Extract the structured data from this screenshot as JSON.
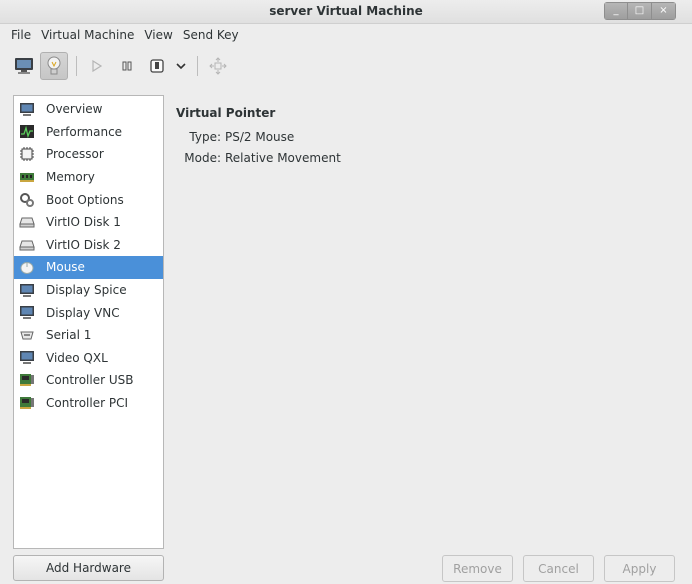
{
  "window": {
    "title": "server Virtual Machine",
    "minimize_label": "_",
    "maximize_label": "□",
    "close_label": "×"
  },
  "menu": {
    "file": "File",
    "virtual_machine": "Virtual Machine",
    "view": "View",
    "send_key": "Send Key"
  },
  "toolbar": {
    "icons": [
      "console-icon",
      "lightbulb-icon",
      "run-icon",
      "pause-icon",
      "shutdown-icon",
      "dropdown-icon",
      "fullscreen-icon"
    ]
  },
  "sidebar": {
    "items": [
      {
        "label": "Overview",
        "icon": "monitor-icon"
      },
      {
        "label": "Performance",
        "icon": "performance-icon"
      },
      {
        "label": "Processor",
        "icon": "cpu-icon"
      },
      {
        "label": "Memory",
        "icon": "memory-icon"
      },
      {
        "label": "Boot Options",
        "icon": "boot-icon"
      },
      {
        "label": "VirtIO Disk 1",
        "icon": "disk-icon"
      },
      {
        "label": "VirtIO Disk 2",
        "icon": "disk-icon"
      },
      {
        "label": "Mouse",
        "icon": "mouse-icon",
        "selected": true
      },
      {
        "label": "Display Spice",
        "icon": "display-icon"
      },
      {
        "label": "Display VNC",
        "icon": "display-icon"
      },
      {
        "label": "Serial 1",
        "icon": "serial-icon"
      },
      {
        "label": "Video QXL",
        "icon": "display-icon"
      },
      {
        "label": "Controller USB",
        "icon": "controller-icon"
      },
      {
        "label": "Controller PCI",
        "icon": "controller-icon"
      }
    ],
    "add_hardware": "Add Hardware"
  },
  "details": {
    "section_title": "Virtual Pointer",
    "type_label": "Type:",
    "type_value": "PS/2 Mouse",
    "mode_label": "Mode:",
    "mode_value": "Relative Movement"
  },
  "buttons": {
    "remove": "Remove",
    "cancel": "Cancel",
    "apply": "Apply"
  },
  "colors": {
    "selection": "#4a90d9",
    "background": "#ededed"
  }
}
